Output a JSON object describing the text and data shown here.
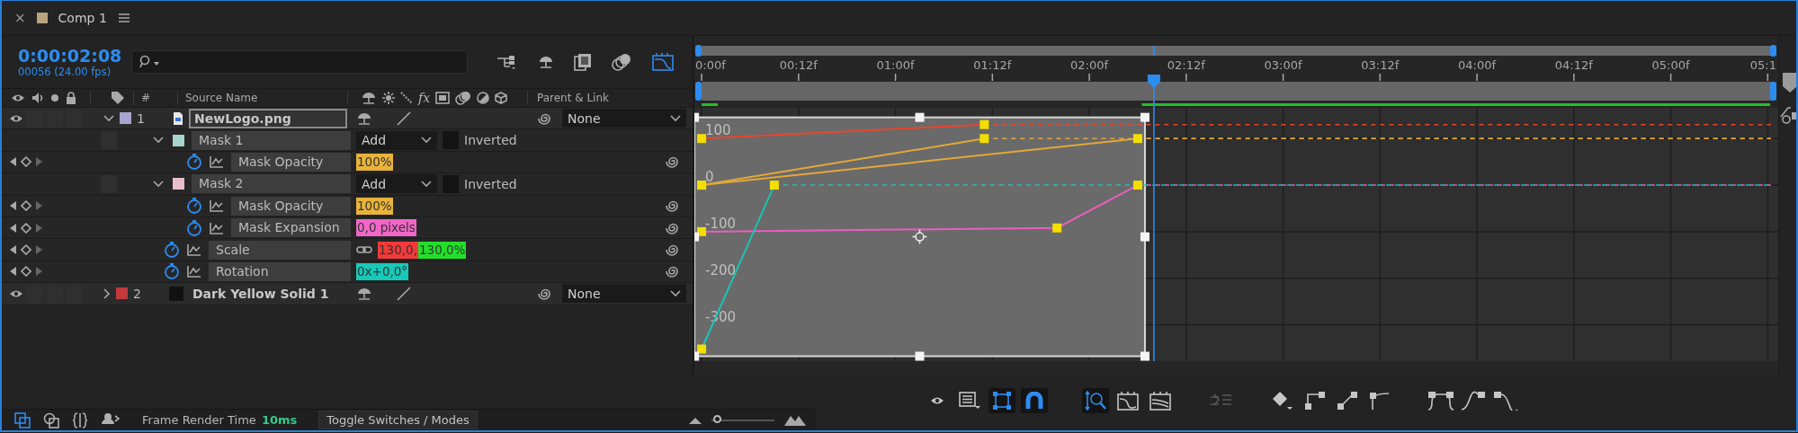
{
  "tab": {
    "close": "×",
    "title": "Comp 1"
  },
  "timecode": "0:00:02:08",
  "frame_info": "00056 (24.00 fps)",
  "toolbar": [
    {
      "kind": "flowchart",
      "on": false
    },
    {
      "kind": "shy",
      "on": false
    },
    {
      "kind": "frame-blend",
      "on": false
    },
    {
      "kind": "motion-blur",
      "on": false
    },
    {
      "kind": "graph-editor",
      "on": true
    }
  ],
  "columns": {
    "number": "#",
    "source_name": "Source Name",
    "effects": "fx",
    "parent": "Parent & Link"
  },
  "layers": [
    {
      "number": "1",
      "name": "NewLogo.png",
      "color": "#a9a5d0",
      "kind": "footage",
      "visible": true,
      "expanded": true,
      "selected": true,
      "parent": "None",
      "children": [
        {
          "kind": "mask",
          "name": "Mask 1",
          "color": "#a7d4cd",
          "expanded": true,
          "mode": "Add",
          "inverted_label": "Inverted",
          "inverted": false,
          "children": [
            {
              "kind": "property",
              "name": "Mask Opacity",
              "values": [
                {
                  "text": "100%",
                  "color": "#e8b33b"
                }
              ]
            }
          ]
        },
        {
          "kind": "mask",
          "name": "Mask 2",
          "color": "#e7bdcc",
          "expanded": true,
          "mode": "Add",
          "inverted_label": "Inverted",
          "inverted": false,
          "children": [
            {
              "kind": "property",
              "name": "Mask Opacity",
              "values": [
                {
                  "text": "100%",
                  "color": "#e8b33b"
                }
              ]
            },
            {
              "kind": "property",
              "name": "Mask Expansion",
              "values": [
                {
                  "text": "0,0 pixels",
                  "color": "#f266c8"
                }
              ]
            }
          ]
        },
        {
          "kind": "property",
          "name": "Scale",
          "linked": true,
          "values": [
            {
              "text": "130,0,",
              "color": "#f23a3a"
            },
            {
              "text": "130,0%",
              "color": "#22e02a"
            }
          ]
        },
        {
          "kind": "property",
          "name": "Rotation",
          "values": [
            {
              "text": "0x+0,0°",
              "color": "#16c9b8"
            }
          ]
        }
      ]
    },
    {
      "number": "2",
      "name": "Dark Yellow Solid 1",
      "color": "#c33a3c",
      "kind": "solid",
      "visible": true,
      "expanded": false,
      "selected": false,
      "parent": "None"
    }
  ],
  "time_ruler": {
    "labels": [
      "0:00f",
      "00:12f",
      "01:00f",
      "01:12f",
      "02:00f",
      "02:12f",
      "03:00f",
      "03:12f",
      "04:00f",
      "04:12f",
      "05:00f",
      "05:1"
    ]
  },
  "graph": {
    "value_labels": [
      "100",
      "0",
      "-100",
      "-200",
      "-300"
    ]
  },
  "graph_toolbar": [
    [
      {
        "kind": "eye",
        "on": false
      },
      {
        "kind": "list",
        "on": false
      },
      {
        "kind": "transform-box",
        "on": true
      },
      {
        "kind": "snap",
        "on": true
      }
    ],
    [
      {
        "kind": "fit-selection",
        "on": true
      },
      {
        "kind": "fit-all",
        "on": false
      },
      {
        "kind": "fit-range",
        "on": false
      }
    ],
    [
      {
        "kind": "separate-dimensions",
        "on": false,
        "disabled": true
      }
    ],
    [
      {
        "kind": "keyframe",
        "on": false
      },
      {
        "kind": "hold",
        "on": false
      },
      {
        "kind": "linear",
        "on": false
      },
      {
        "kind": "auto-bezier",
        "on": false
      }
    ],
    [
      {
        "kind": "easy-ease",
        "on": false
      },
      {
        "kind": "ease-in",
        "on": false
      },
      {
        "kind": "ease-out",
        "on": false
      }
    ]
  ],
  "status_bar": {
    "icons": [
      {
        "kind": "comp-flow",
        "on": true
      },
      {
        "kind": "mini-flow",
        "on": false
      },
      {
        "kind": "braces",
        "on": false
      },
      {
        "kind": "draft",
        "on": false
      }
    ],
    "label": "Frame Render Time",
    "value": "10ms",
    "toggle_button": "Toggle Switches / Modes",
    "zoom": {
      "level": 0.08
    }
  }
}
